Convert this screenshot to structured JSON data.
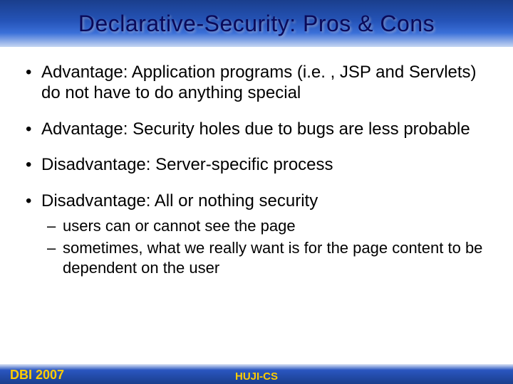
{
  "title": "Declarative-Security: Pros & Cons",
  "bullets": [
    {
      "text": "Advantage: Application programs (i.e. , JSP and Servlets) do not have to do anything special"
    },
    {
      "text": "Advantage: Security holes due to bugs are less probable"
    },
    {
      "text": "Disadvantage: Server-specific process"
    },
    {
      "text": "Disadvantage: All or nothing security",
      "sub": [
        "users can or cannot see the page",
        "sometimes, what we really want is for the page content to be dependent on the user"
      ]
    }
  ],
  "footer": {
    "left": "DBI 2007",
    "center": "HUJI-CS"
  }
}
